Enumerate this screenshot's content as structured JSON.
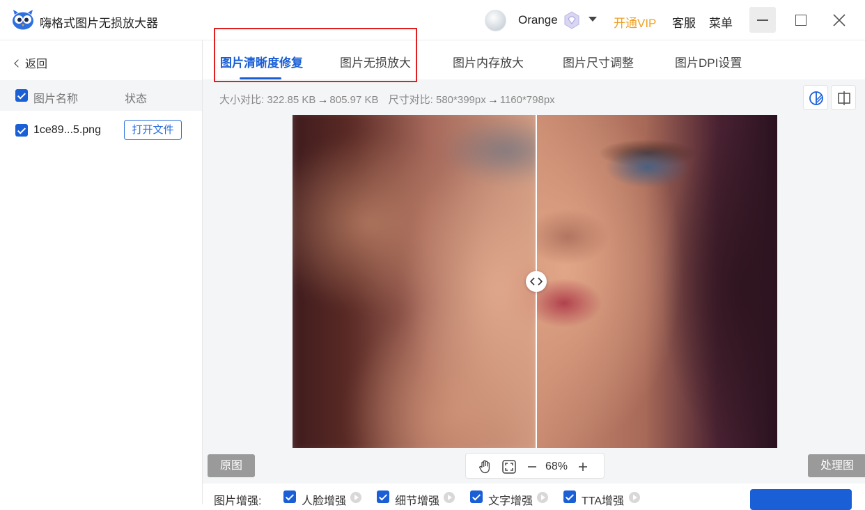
{
  "app": {
    "title": "嗨格式图片无损放大器",
    "logo_icon": "owl-logo-icon"
  },
  "user": {
    "name": "Orange",
    "badge_icon": "vip-diamond-icon"
  },
  "header_links": {
    "vip": "开通VIP",
    "service": "客服",
    "menu": "菜单"
  },
  "sidebar": {
    "back_label": "返回",
    "columns": {
      "name": "图片名称",
      "status": "状态"
    },
    "files": [
      {
        "name": "1ce89...5.png",
        "action": "打开文件",
        "checked": true
      }
    ]
  },
  "tabs": [
    {
      "label": "图片清晰度修复",
      "active": true
    },
    {
      "label": "图片无损放大",
      "active": false
    },
    {
      "label": "图片内存放大",
      "active": false
    },
    {
      "label": "图片尺寸调整",
      "active": false
    },
    {
      "label": "图片DPI设置",
      "active": false
    }
  ],
  "compare": {
    "size_label": "大小对比:",
    "size_from": "322.85 KB",
    "size_to": "805.97 KB",
    "dim_label": "尺寸对比:",
    "dim_from": "580*399px",
    "dim_to": "1160*798px"
  },
  "viewer": {
    "original_label": "原图",
    "processed_label": "处理图",
    "zoom": "68%"
  },
  "enhance": {
    "label": "图片增强:",
    "options": [
      {
        "label": "人脸增强",
        "checked": true
      },
      {
        "label": "细节增强",
        "checked": true
      },
      {
        "label": "文字增强",
        "checked": true
      },
      {
        "label": "TTA增强",
        "checked": true
      }
    ]
  },
  "colors": {
    "accent": "#1a5fd6",
    "vip": "#f0a020",
    "highlight": "#e02020"
  }
}
